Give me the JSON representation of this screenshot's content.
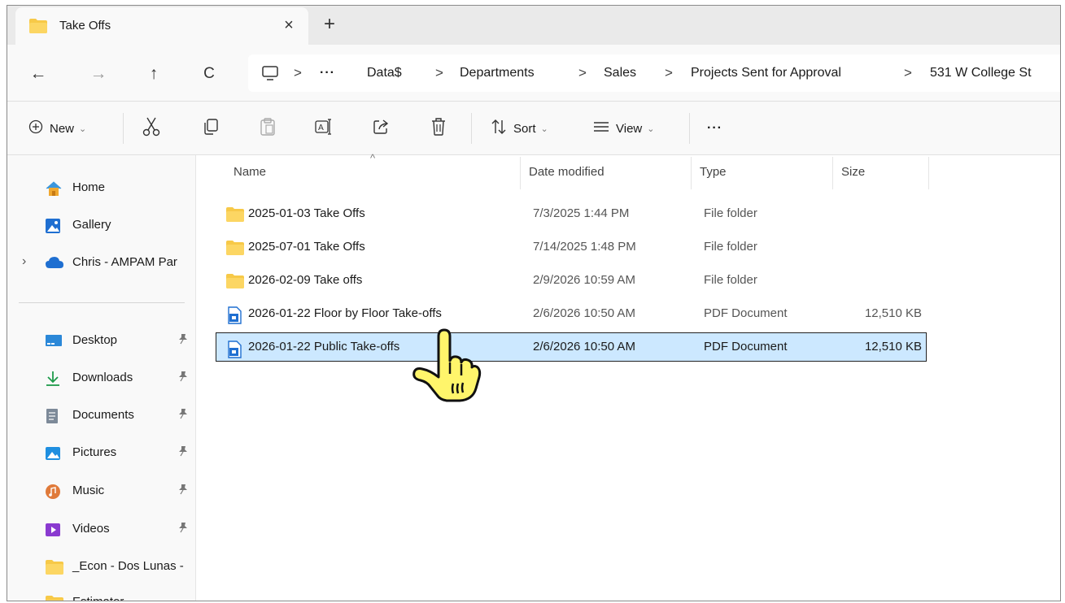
{
  "tab": {
    "title": "Take Offs",
    "close": "×",
    "new_tab": "+"
  },
  "nav": {
    "back": "←",
    "forward": "→",
    "up": "↑",
    "refresh": "C"
  },
  "breadcrumbs": {
    "overflow": "···",
    "items": [
      "Data$",
      "Departments",
      "Sales",
      "Projects Sent for Approval",
      "531 W College St"
    ],
    "separator": ">"
  },
  "commands": {
    "new_label": "New",
    "sort_label": "Sort",
    "view_label": "View",
    "more": "···",
    "chevron": "⌄"
  },
  "sidebar": {
    "home": "Home",
    "gallery": "Gallery",
    "onedrive": "Chris - AMPAM Par",
    "expand": "›",
    "pin": "📌",
    "quick": [
      "Desktop",
      "Downloads",
      "Documents",
      "Pictures",
      "Music",
      "Videos",
      "_Econ - Dos Lunas -",
      "Estimator"
    ]
  },
  "columns": {
    "name": "Name",
    "date": "Date modified",
    "type": "Type",
    "size": "Size",
    "sort_caret": "^"
  },
  "files": [
    {
      "name": "2025-01-03 Take Offs",
      "date": "7/3/2025 1:44 PM",
      "type": "File folder",
      "size": "",
      "kind": "folder"
    },
    {
      "name": "2025-07-01 Take Offs",
      "date": "7/14/2025 1:48 PM",
      "type": "File folder",
      "size": "",
      "kind": "folder"
    },
    {
      "name": "2026-02-09 Take offs",
      "date": "2/9/2026 10:59 AM",
      "type": "File folder",
      "size": "",
      "kind": "folder"
    },
    {
      "name": "2026-01-22 Floor by Floor Take-offs",
      "date": "2/6/2026 10:50 AM",
      "type": "PDF Document",
      "size": "12,510 KB",
      "kind": "pdf"
    },
    {
      "name": "2026-01-22 Public Take-offs",
      "date": "2/6/2026 10:50 AM",
      "type": "PDF Document",
      "size": "12,510 KB",
      "kind": "pdf",
      "selected": true
    }
  ],
  "colors": {
    "folder": "#f7c948",
    "selection": "#cce8ff",
    "pdf": "#1f6fd1",
    "hand": "#fff56b"
  }
}
